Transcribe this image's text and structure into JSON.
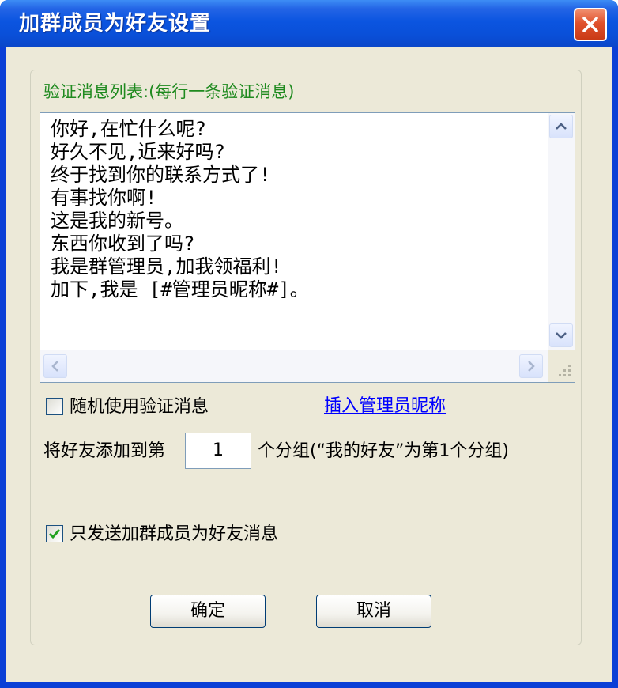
{
  "window": {
    "title": "加群成员为好友设置"
  },
  "group": {
    "label": "验证消息列表:(每行一条验证消息)",
    "messages": "你好,在忙什么呢?\n好久不见,近来好吗?\n终于找到你的联系方式了!\n有事找你啊!\n这是我的新号。\n东西你收到了吗?\n我是群管理员,加我领福利!\n加下,我是 [#管理员昵称#]。"
  },
  "options": {
    "random_label": "随机使用验证消息",
    "random_checked": false,
    "insert_link": "插入管理员昵称",
    "group_prefix": "将好友添加到第",
    "group_number": "1",
    "group_suffix": "个分组(“我的好友”为第1个分组)",
    "only_send_label": "只发送加群成员为好友消息",
    "only_send_checked": true
  },
  "buttons": {
    "ok": "确定",
    "cancel": "取消"
  },
  "colors": {
    "title_bar": "#0a4fd8",
    "dialog_bg": "#ece9d8",
    "group_label": "#1f8a1f",
    "link": "#0000ff",
    "close_button": "#e0512c",
    "checkmark": "#21a121"
  },
  "icons": {
    "close": "close-x-icon",
    "scroll_up": "arrow-up-icon",
    "scroll_down": "arrow-down-icon",
    "scroll_left": "arrow-left-icon",
    "scroll_right": "arrow-right-icon",
    "check": "checkmark-icon",
    "grip": "resize-grip-icon"
  }
}
